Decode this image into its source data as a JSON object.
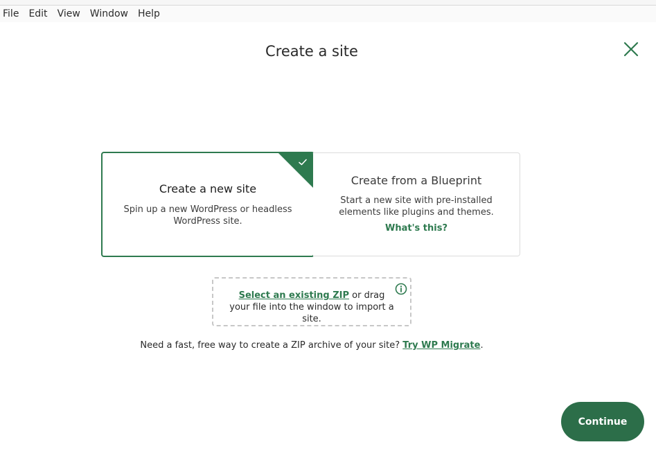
{
  "menubar": {
    "items": [
      "File",
      "Edit",
      "View",
      "Window",
      "Help"
    ]
  },
  "dialog": {
    "title": "Create a site",
    "close_icon": "close-icon"
  },
  "options": {
    "new_site": {
      "title": "Create a new site",
      "description": "Spin up a new WordPress or headless WordPress site.",
      "selected": true,
      "badge_icon": "checkmark-icon"
    },
    "blueprint": {
      "title": "Create from a Blueprint",
      "description": "Start a new site with pre-installed elements like plugins and themes.",
      "link": "What's this?"
    }
  },
  "import": {
    "link": "Select an existing ZIP",
    "text": " or drag your file into the window to import a site.",
    "info_icon": "info-icon"
  },
  "footer": {
    "text": "Need a fast, free way to create a ZIP archive of your site? ",
    "link": "Try WP Migrate",
    "suffix": "."
  },
  "actions": {
    "continue_label": "Continue"
  },
  "colors": {
    "accent": "#2e7a4f",
    "button": "#2c6e49"
  }
}
